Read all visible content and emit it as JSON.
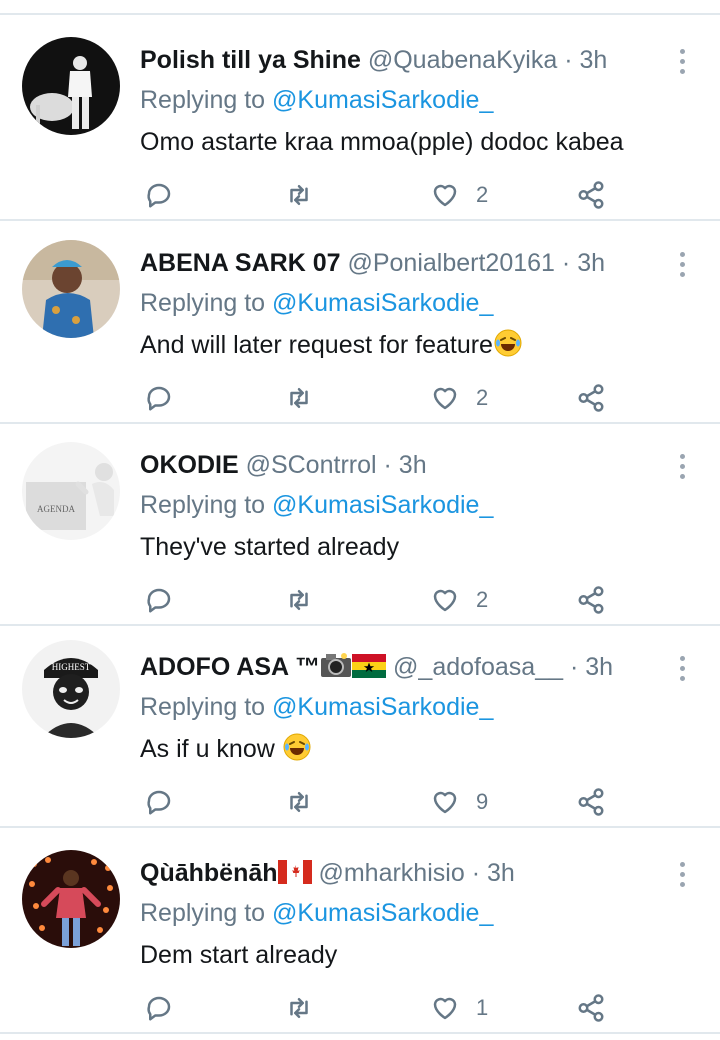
{
  "tweets": [
    {
      "name": "Polish till ya Shine",
      "handle": "@QuabenaKyika",
      "time": "3h",
      "replying_prefix": "Replying to",
      "replying_to": "@KumasiSarkodie_",
      "text": "Omo astarte kraa mmoa(pple) dodoc kabea",
      "likes": "2"
    },
    {
      "name": "ABENA SARK 07",
      "handle": "@Ponialbert20161",
      "time": "3h",
      "replying_prefix": "Replying to",
      "replying_to": "@KumasiSarkodie_",
      "text": "And will later request for feature",
      "likes": "2"
    },
    {
      "name": "OKODIE",
      "handle": "@SContrrol",
      "time": "3h",
      "replying_prefix": "Replying to",
      "replying_to": "@KumasiSarkodie_",
      "text": "They've started already",
      "avatar_text": "AGENDA",
      "likes": "2"
    },
    {
      "name": "ADOFO ASA ™",
      "handle": "@_adofoasa__",
      "time": "3h",
      "replying_prefix": "Replying to",
      "replying_to": "@KumasiSarkodie_",
      "text": "As if u know ",
      "avatar_text": "HIGHEST",
      "likes": "9"
    },
    {
      "name": "Qùāhbënāh",
      "handle": "@mharkhisio",
      "time": "3h",
      "replying_prefix": "Replying to",
      "replying_to": "@KumasiSarkodie_",
      "text": "Dem start already",
      "likes": "1"
    }
  ],
  "separator": "·",
  "icons": {
    "reply": "reply-icon",
    "retweet": "retweet-icon",
    "like": "heart-icon",
    "share": "share-icon",
    "more": "more-vertical-icon"
  },
  "colors": {
    "mention": "#1b95e0",
    "muted": "#657786",
    "text": "#14171a",
    "divider": "#e1e8ed"
  }
}
